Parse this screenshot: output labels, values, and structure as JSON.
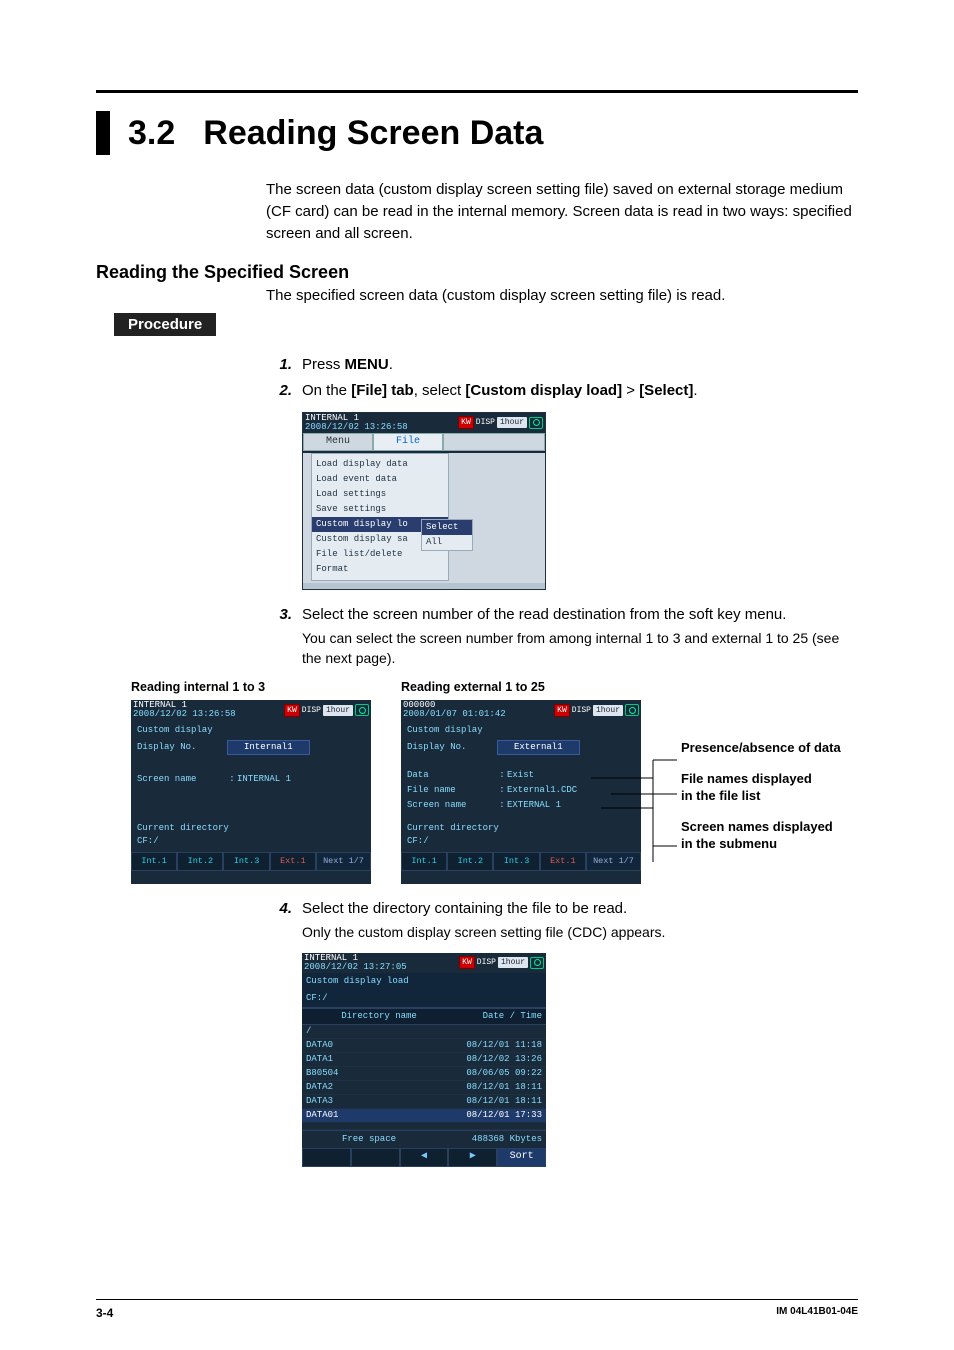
{
  "section": {
    "num": "3.2",
    "title": "Reading Screen Data"
  },
  "intro": "The screen data (custom display screen setting file) saved on external storage medium (CF card) can be read in the internal memory. Screen data is read in two ways: specified screen and all screen.",
  "sub1": {
    "heading": "Reading the Specified Screen",
    "text": "The specified screen data (custom display screen setting file) is read."
  },
  "procedure_label": "Procedure",
  "steps": {
    "s1_a": "Press ",
    "s1_b": "MENU",
    "s1_c": ".",
    "s2_a": "On the ",
    "s2_b": "[File] tab",
    "s2_c": ", select ",
    "s2_d": "[Custom display load]",
    "s2_e": " > ",
    "s2_f": "[Select]",
    "s2_g": ".",
    "s3_a": "Select the screen number of the read destination from the soft key menu.",
    "s3_b": "You can select the screen number from among internal 1 to 3 and external 1 to 25 (see the next page).",
    "s4_a": "Select the directory containing the file to be read.",
    "s4_b": "Only the custom display screen setting file (CDC) appears."
  },
  "shot1": {
    "head_l1": "INTERNAL 1",
    "head_l2": "2008/12/02 13:26:58",
    "disp": "DISP",
    "hour": "1hour",
    "tab_menu": "Menu",
    "tab_file": "File",
    "items": [
      "Load display data",
      "Load event data",
      "Load settings",
      "Save settings",
      "Custom display lo",
      "Custom display sa",
      "File list/delete",
      "Format"
    ],
    "sub": [
      "Select",
      "All"
    ]
  },
  "panelA": {
    "title": "Reading internal 1 to 3",
    "head_l1": "INTERNAL 1",
    "head_l2": "2008/12/02 13:26:58",
    "t1": "Custom display",
    "t2": "Display No.",
    "v2": "Internal1",
    "t3": "Screen name",
    "v3": "INTERNAL 1",
    "cd": "Current directory",
    "cd2": "CF:/",
    "sk": [
      "Int.1",
      "Int.2",
      "Int.3",
      "Ext.1",
      "Next 1/7"
    ]
  },
  "panelB": {
    "title": "Reading external 1 to 25",
    "head_l1": "000000",
    "head_l2": "2008/01/07 01:01:42",
    "t1": "Custom display",
    "t2": "Display No.",
    "v2": "External1",
    "r_data_l": "Data",
    "r_data_v": "Exist",
    "r_file_l": "File name",
    "r_file_v": "External1.CDC",
    "r_scr_l": "Screen name",
    "r_scr_v": "EXTERNAL 1",
    "cd": "Current directory",
    "cd2": "CF:/",
    "sk": [
      "Int.1",
      "Int.2",
      "Int.3",
      "Ext.1",
      "Next 1/7"
    ]
  },
  "annots": {
    "a1": "Presence/absence of data",
    "a2a": "File names displayed",
    "a2b": "in the file list",
    "a3a": "Screen names displayed",
    "a3b": "in the submenu"
  },
  "shot4": {
    "head_l1": "INTERNAL 1",
    "head_l2": "2008/12/02 13:27:05",
    "subtitle": "Custom display load",
    "path": "CF:/",
    "col1": "Directory name",
    "col2": "Date / Time",
    "rows": [
      {
        "n": "/",
        "d": ""
      },
      {
        "n": "DATA0",
        "d": "08/12/01 11:18"
      },
      {
        "n": "DATA1",
        "d": "08/12/02 13:26"
      },
      {
        "n": "B80504",
        "d": "08/06/05 09:22"
      },
      {
        "n": "DATA2",
        "d": "08/12/01 18:11"
      },
      {
        "n": "DATA3",
        "d": "08/12/01 18:11"
      },
      {
        "n": "DATA01",
        "d": "08/12/01 17:33"
      }
    ],
    "sel_index": 6,
    "free_l": "Free space",
    "free_v": "488368 Kbytes",
    "nav_left": "◀",
    "nav_right": "▶",
    "nav_sort": "Sort"
  },
  "footer": {
    "page": "3-4",
    "doc": "IM 04L41B01-04E"
  }
}
